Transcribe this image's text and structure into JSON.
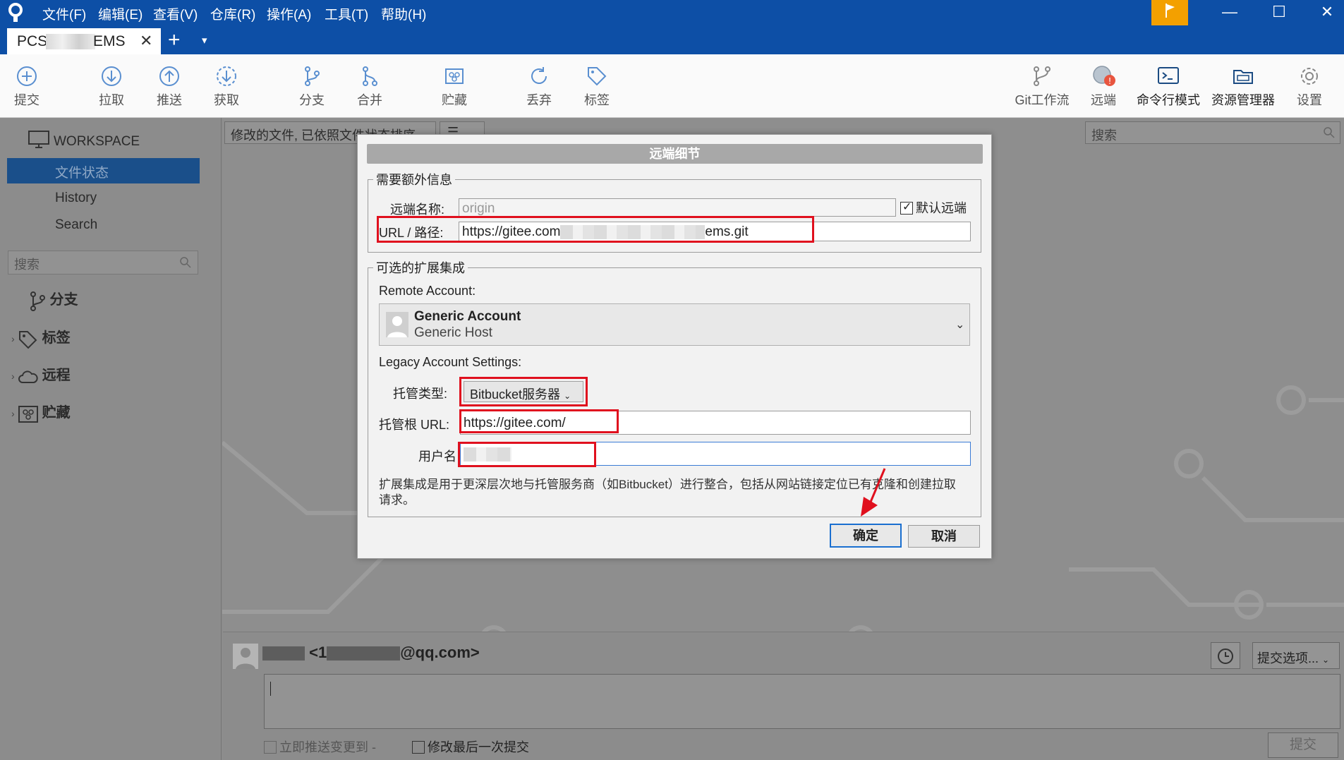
{
  "menu": [
    "文件(F)",
    "编辑(E)",
    "查看(V)",
    "仓库(R)",
    "操作(A)",
    "工具(T)",
    "帮助(H)"
  ],
  "tab": {
    "title_left": "PCS",
    "title_right": "EMS",
    "close": "✕",
    "add": "+",
    "menu": "▾"
  },
  "toolbar": {
    "commit": "提交",
    "pull": "拉取",
    "push": "推送",
    "fetch": "获取",
    "branch": "分支",
    "merge": "合并",
    "stash": "贮藏",
    "discard": "丢弃",
    "tag": "标签",
    "git_flow": "Git工作流",
    "remote": "远端",
    "terminal": "命令行模式",
    "explorer": "资源管理器",
    "settings": "设置"
  },
  "sidebar": {
    "workspace": "WORKSPACE",
    "items": [
      "文件状态",
      "History",
      "Search"
    ],
    "search_placeholder": "搜索",
    "groups": [
      "分支",
      "标签",
      "远程",
      "贮藏"
    ]
  },
  "main": {
    "filter": "修改的文件, 已依照文件状态排序",
    "view_icon": "☰",
    "search_placeholder": "搜索"
  },
  "commit": {
    "author_prefix": "<1",
    "author_suffix": "@qq.com>",
    "options": "提交选项...",
    "push_now": "立即推送变更到 -",
    "amend": "修改最后一次提交",
    "commit_button": "提交"
  },
  "dialog": {
    "title": "远端细节",
    "section_required": "需要额外信息",
    "remote_name_label": "远端名称:",
    "remote_name_value": "origin",
    "default_remote": "默认远端",
    "url_label": "URL / 路径:",
    "url_prefix": "https://gitee.com",
    "url_suffix": "ems.git",
    "section_optional": "可选的扩展集成",
    "remote_account_label": "Remote Account:",
    "account_name": "Generic Account",
    "account_host": "Generic Host",
    "legacy_label": "Legacy Account Settings:",
    "host_type_label": "托管类型:",
    "host_type_value": "Bitbucket服务器",
    "host_root_label": "托管根 URL:",
    "host_root_value": "https://gitee.com/",
    "username_label": "用户名",
    "note": "扩展集成是用于更深层次地与托管服务商（如Bitbucket）进行整合，包括从网站链接定位已有克隆和创建拉取请求。",
    "ok": "确定",
    "cancel": "取消"
  },
  "colors": {
    "titlebar": "#0d4fa6",
    "highlight": "#e0101e",
    "flag": "#f3a000"
  }
}
